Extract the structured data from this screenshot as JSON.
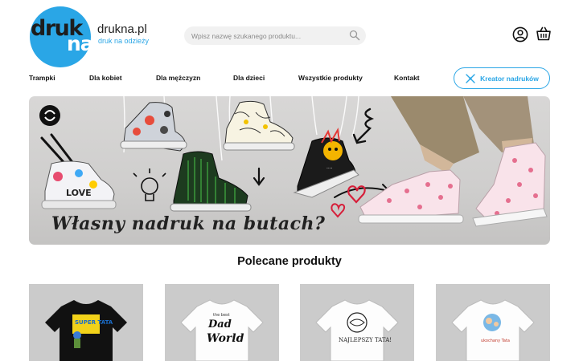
{
  "brand": {
    "logo_top": "druk",
    "logo_bottom": "na",
    "name": "drukna.pl",
    "tagline": "druk na odzieży",
    "accent_color": "#2aa6e6"
  },
  "search": {
    "placeholder": "Wpisz nazwę szukanego produktu...",
    "value": "",
    "icon": "search-icon"
  },
  "header_icons": [
    "user-icon",
    "cart-icon"
  ],
  "nav": {
    "items": [
      {
        "label": "Trampki"
      },
      {
        "label": "Dla kobiet"
      },
      {
        "label": "Dla mężczyzn"
      },
      {
        "label": "Dla dzieci"
      },
      {
        "label": "Wszystkie produkty"
      },
      {
        "label": "Kontakt"
      }
    ],
    "creator_button": {
      "label": "Kreator nadruków",
      "icon": "pen-tool-icon"
    }
  },
  "banner": {
    "caption": "Własny nadruk na butach?",
    "shoe_texts": {
      "love": "LOVE",
      "dots": "...."
    }
  },
  "featured": {
    "title": "Polecane produkty",
    "products": [
      {
        "shirt_color": "#111111",
        "print_text": "SUPER TATA"
      },
      {
        "shirt_color": "#ffffff",
        "print_text": "Dad World"
      },
      {
        "shirt_color": "#ffffff",
        "print_text": "NAJLEPSZY TATA!"
      },
      {
        "shirt_color": "#ffffff",
        "print_text": "ukochany Tata"
      }
    ]
  }
}
